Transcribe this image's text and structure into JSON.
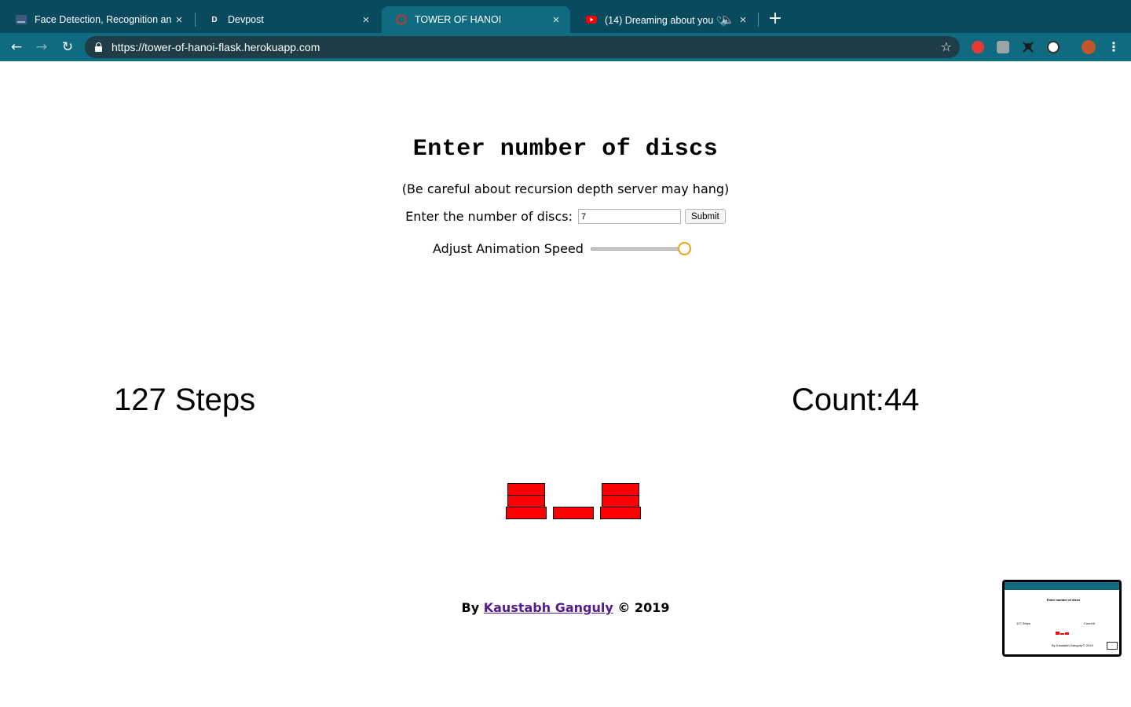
{
  "browser": {
    "tabs": [
      {
        "title": "Face Detection, Recognition an",
        "favicon": "image-icon",
        "active": false
      },
      {
        "title": "Devpost",
        "favicon": "D",
        "active": false
      },
      {
        "title": "TOWER OF HANOI",
        "favicon": "globe-icon",
        "active": true
      },
      {
        "title": "(14) Dreaming about you ♡",
        "favicon": "youtube-icon",
        "active": false,
        "audio": true
      }
    ],
    "new_tab_label": "+",
    "url": "https://tower-of-hanoi-flask.herokuapp.com",
    "colors": {
      "tabbar": "#0a4a5e",
      "toolbar": "#106b80",
      "omnibox": "#1e3d47"
    }
  },
  "page": {
    "heading": "Enter number of discs",
    "warning": "(Be careful about recursion depth server may hang)",
    "disc_label": "Enter the number of discs:",
    "disc_value": "7",
    "submit_label": "Submit",
    "speed_label": "Adjust Animation Speed",
    "speed_fraction": 1.0,
    "steps_text": "127 Steps",
    "count_text": "Count:44",
    "towers": [
      {
        "discs": 3
      },
      {
        "discs": 1
      },
      {
        "discs": 3
      }
    ],
    "disc_color": "#ff0000",
    "footer": {
      "prefix": "By",
      "author": "Kaustabh Ganguly",
      "suffix": "© 2019"
    }
  },
  "preview": {
    "heading": "Enter number of discs",
    "steps_text": "127 Steps",
    "count_text": "Count:6",
    "footer_text": "By Kaustabh Ganguly © 2019"
  }
}
